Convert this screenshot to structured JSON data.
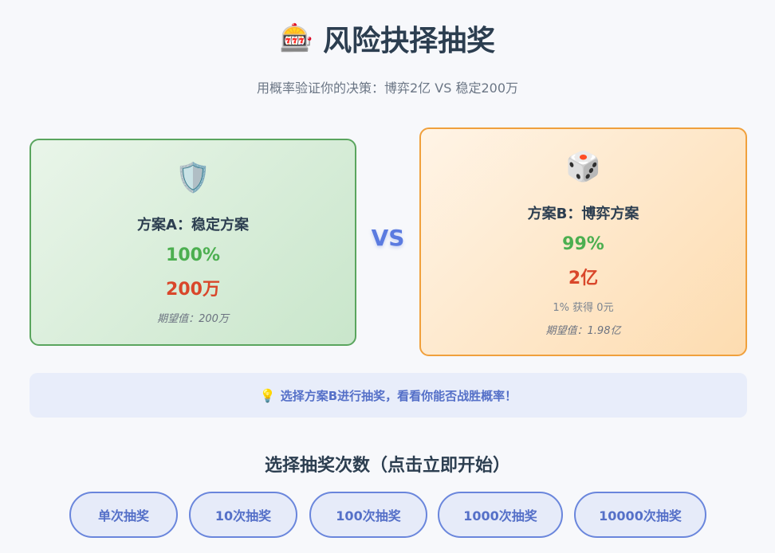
{
  "header": {
    "icon": "🎰",
    "title": "风险抉择抽奖",
    "subtitle": "用概率验证你的决策：博弈2亿 VS 稳定200万"
  },
  "option_a": {
    "icon": "🛡️",
    "name": "方案A：稳定方案",
    "probability": "100%",
    "amount": "200万",
    "expected_value": "期望值：200万"
  },
  "vs_label": "VS",
  "option_b": {
    "icon": "🎲",
    "name": "方案B：博弈方案",
    "probability": "99%",
    "amount": "2亿",
    "fail_note": "1% 获得 0元",
    "expected_value": "期望值：1.98亿"
  },
  "tip": {
    "icon": "💡",
    "text": "选择方案B进行抽奖，看看你能否战胜概率！"
  },
  "draw": {
    "title": "选择抽奖次数（点击立即开始）",
    "buttons": [
      "单次抽奖",
      "10次抽奖",
      "100次抽奖",
      "1000次抽奖",
      "10000次抽奖"
    ]
  },
  "colors": {
    "accent": "#5b7be0",
    "success": "#4caf50",
    "danger": "#d9472b",
    "option_a_border": "#5aa55e",
    "option_b_border": "#f0a03c"
  }
}
